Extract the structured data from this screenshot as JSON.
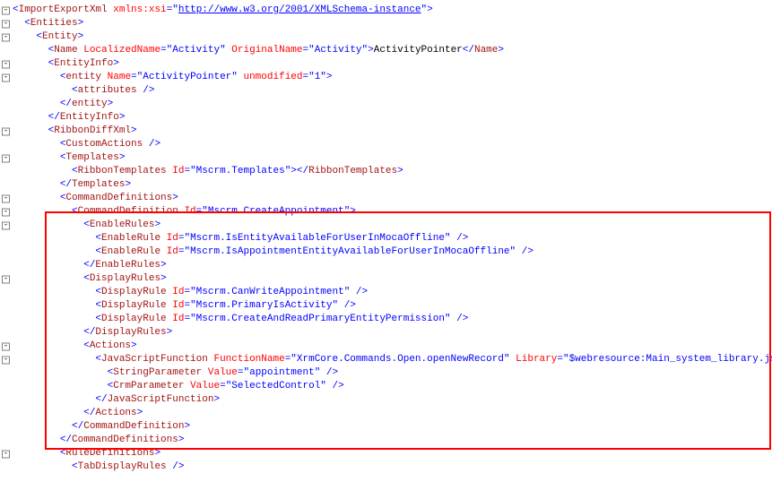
{
  "link": "http://www.w3.org/2001/XMLSchema-instance",
  "l0": {
    "tag": "ImportExportXml",
    "attr": "xmlns:xsi"
  },
  "l1": {
    "tag": "Entities"
  },
  "l2": {
    "tag": "Entity"
  },
  "l3": {
    "tag": "Name",
    "a1n": "LocalizedName",
    "a1v": "\"Activity\"",
    "a2n": "OriginalName",
    "a2v": "\"Activity\"",
    "text": "ActivityPointer",
    "close": "Name"
  },
  "l4": {
    "tag": "EntityInfo"
  },
  "l5": {
    "tag": "entity",
    "a1n": "Name",
    "a1v": "\"ActivityPointer\"",
    "a2n": "unmodified",
    "a2v": "\"1\""
  },
  "l6": {
    "tag": "attributes"
  },
  "l7": {
    "tag": "entity"
  },
  "l8": {
    "tag": "EntityInfo"
  },
  "l9": {
    "tag": "RibbonDiffXml"
  },
  "l10": {
    "tag": "CustomActions"
  },
  "l11": {
    "tag": "Templates"
  },
  "l12": {
    "tag": "RibbonTemplates",
    "a1n": "Id",
    "a1v": "\"Mscrm.Templates\"",
    "close": "RibbonTemplates"
  },
  "l13": {
    "tag": "Templates"
  },
  "l14": {
    "tag": "CommandDefinitions"
  },
  "l15": {
    "tag": "CommandDefinition",
    "a1n": "Id",
    "a1v": "\"Mscrm.CreateAppointment\""
  },
  "l16": {
    "tag": "EnableRules"
  },
  "l17": {
    "tag": "EnableRule",
    "a1n": "Id",
    "a1v": "\"Mscrm.IsEntityAvailableForUserInMocaOffline\""
  },
  "l18": {
    "tag": "EnableRule",
    "a1n": "Id",
    "a1v": "\"Mscrm.IsAppointmentEntityAvailableForUserInMocaOffline\""
  },
  "l19": {
    "tag": "EnableRules"
  },
  "l20": {
    "tag": "DisplayRules"
  },
  "l21": {
    "tag": "DisplayRule",
    "a1n": "Id",
    "a1v": "\"Mscrm.CanWriteAppointment\""
  },
  "l22": {
    "tag": "DisplayRule",
    "a1n": "Id",
    "a1v": "\"Mscrm.PrimaryIsActivity\""
  },
  "l23": {
    "tag": "DisplayRule",
    "a1n": "Id",
    "a1v": "\"Mscrm.CreateAndReadPrimaryEntityPermission\""
  },
  "l24": {
    "tag": "DisplayRules"
  },
  "l25": {
    "tag": "Actions"
  },
  "l26": {
    "tag": "JavaScriptFunction",
    "a1n": "FunctionName",
    "a1v": "\"XrmCore.Commands.Open.openNewRecord\"",
    "a2n": "Library",
    "a2v": "\"$webresource:Main_system_library.js\""
  },
  "l27": {
    "tag": "StringParameter",
    "a1n": "Value",
    "a1v": "\"appointment\""
  },
  "l28": {
    "tag": "CrmParameter",
    "a1n": "Value",
    "a1v": "\"SelectedControl\""
  },
  "l29": {
    "tag": "JavaScriptFunction"
  },
  "l30": {
    "tag": "Actions"
  },
  "l31": {
    "tag": "CommandDefinition"
  },
  "l32": {
    "tag": "CommandDefinitions"
  },
  "l33": {
    "tag": "RuleDefinitions"
  },
  "l34": {
    "tag": "TabDisplayRules"
  },
  "markers": {
    "minus": "-"
  }
}
